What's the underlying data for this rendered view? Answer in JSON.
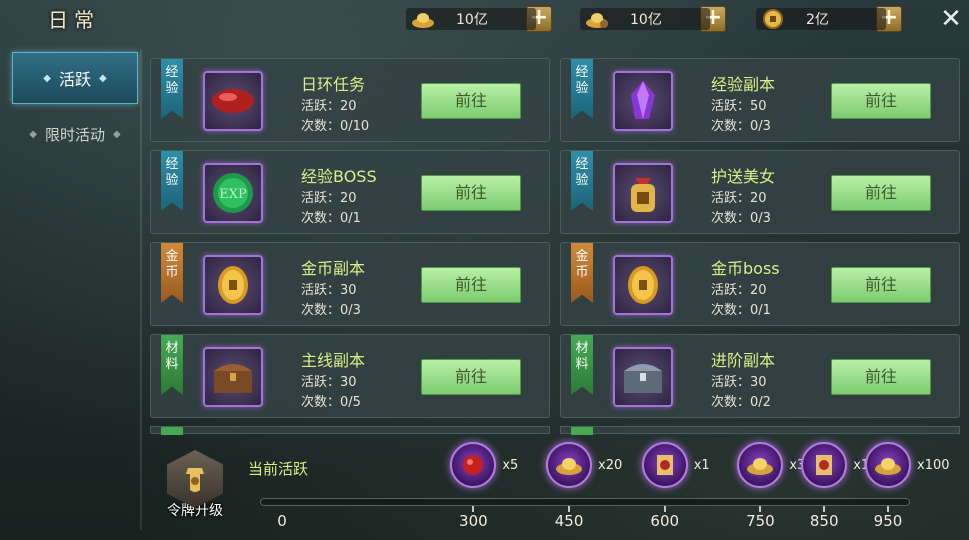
{
  "window": {
    "title": "日常"
  },
  "currencies": [
    {
      "icon": "gold-ingot-icon",
      "value": "10亿"
    },
    {
      "icon": "bound-gold-ingot-icon",
      "value": "10亿"
    },
    {
      "icon": "coin-icon",
      "value": "2亿"
    }
  ],
  "sidebar": {
    "items": [
      {
        "label": "活跃",
        "active": true
      },
      {
        "label": "限时活动",
        "active": false
      }
    ]
  },
  "tasks": [
    {
      "category": "经验",
      "category_type": "exp",
      "name": "日环任务",
      "activity": "活跃：20",
      "count": "次数：0/10",
      "icon": "red-gem-icon",
      "button": "前往"
    },
    {
      "category": "经验",
      "category_type": "exp",
      "name": "经验副本",
      "activity": "活跃：50",
      "count": "次数：0/3",
      "icon": "purple-crystal-icon",
      "button": "前往"
    },
    {
      "category": "经验",
      "category_type": "exp",
      "name": "经验BOSS",
      "activity": "活跃：20",
      "count": "次数：0/1",
      "icon": "exp-orb-icon",
      "button": "前往"
    },
    {
      "category": "经验",
      "category_type": "exp",
      "name": "护送美女",
      "activity": "活跃：20",
      "count": "次数：0/3",
      "icon": "pouch-icon",
      "button": "前往"
    },
    {
      "category": "金币",
      "category_type": "gold",
      "name": "金币副本",
      "activity": "活跃：30",
      "count": "次数：0/3",
      "icon": "coin-icon",
      "button": "前往"
    },
    {
      "category": "金币",
      "category_type": "gold",
      "name": "金币boss",
      "activity": "活跃：20",
      "count": "次数：0/1",
      "icon": "coin-icon",
      "button": "前往"
    },
    {
      "category": "材料",
      "category_type": "mat",
      "name": "主线副本",
      "activity": "活跃：30",
      "count": "次数：0/5",
      "icon": "wooden-chest-icon",
      "button": "前往"
    },
    {
      "category": "材料",
      "category_type": "mat",
      "name": "进阶副本",
      "activity": "活跃：30",
      "count": "次数：0/2",
      "icon": "iron-chest-icon",
      "button": "前往"
    }
  ],
  "progress": {
    "upgrade_label": "令牌升级",
    "current_label": "当前活跃",
    "current_value": 0,
    "max_value": 950,
    "ticks": [
      "0",
      "300",
      "450",
      "600",
      "750",
      "850",
      "950"
    ],
    "rewards": [
      {
        "icon": "red-gem-icon",
        "qty": "x5"
      },
      {
        "icon": "gold-ingot-icon",
        "qty": "x20"
      },
      {
        "icon": "scroll-icon",
        "qty": "x1"
      },
      {
        "icon": "gold-ingot-icon",
        "qty": "x30"
      },
      {
        "icon": "scroll-icon",
        "qty": "x1"
      },
      {
        "icon": "gold-ingot-icon",
        "qty": "x100"
      }
    ]
  },
  "colors": {
    "accent_green": "#7ccc71",
    "name_green": "#d7f08a",
    "exp_ribbon": "#2f8fa8",
    "gold_ribbon": "#d18a3c",
    "mat_ribbon": "#48a955",
    "frame_purple": "#a472d8"
  }
}
